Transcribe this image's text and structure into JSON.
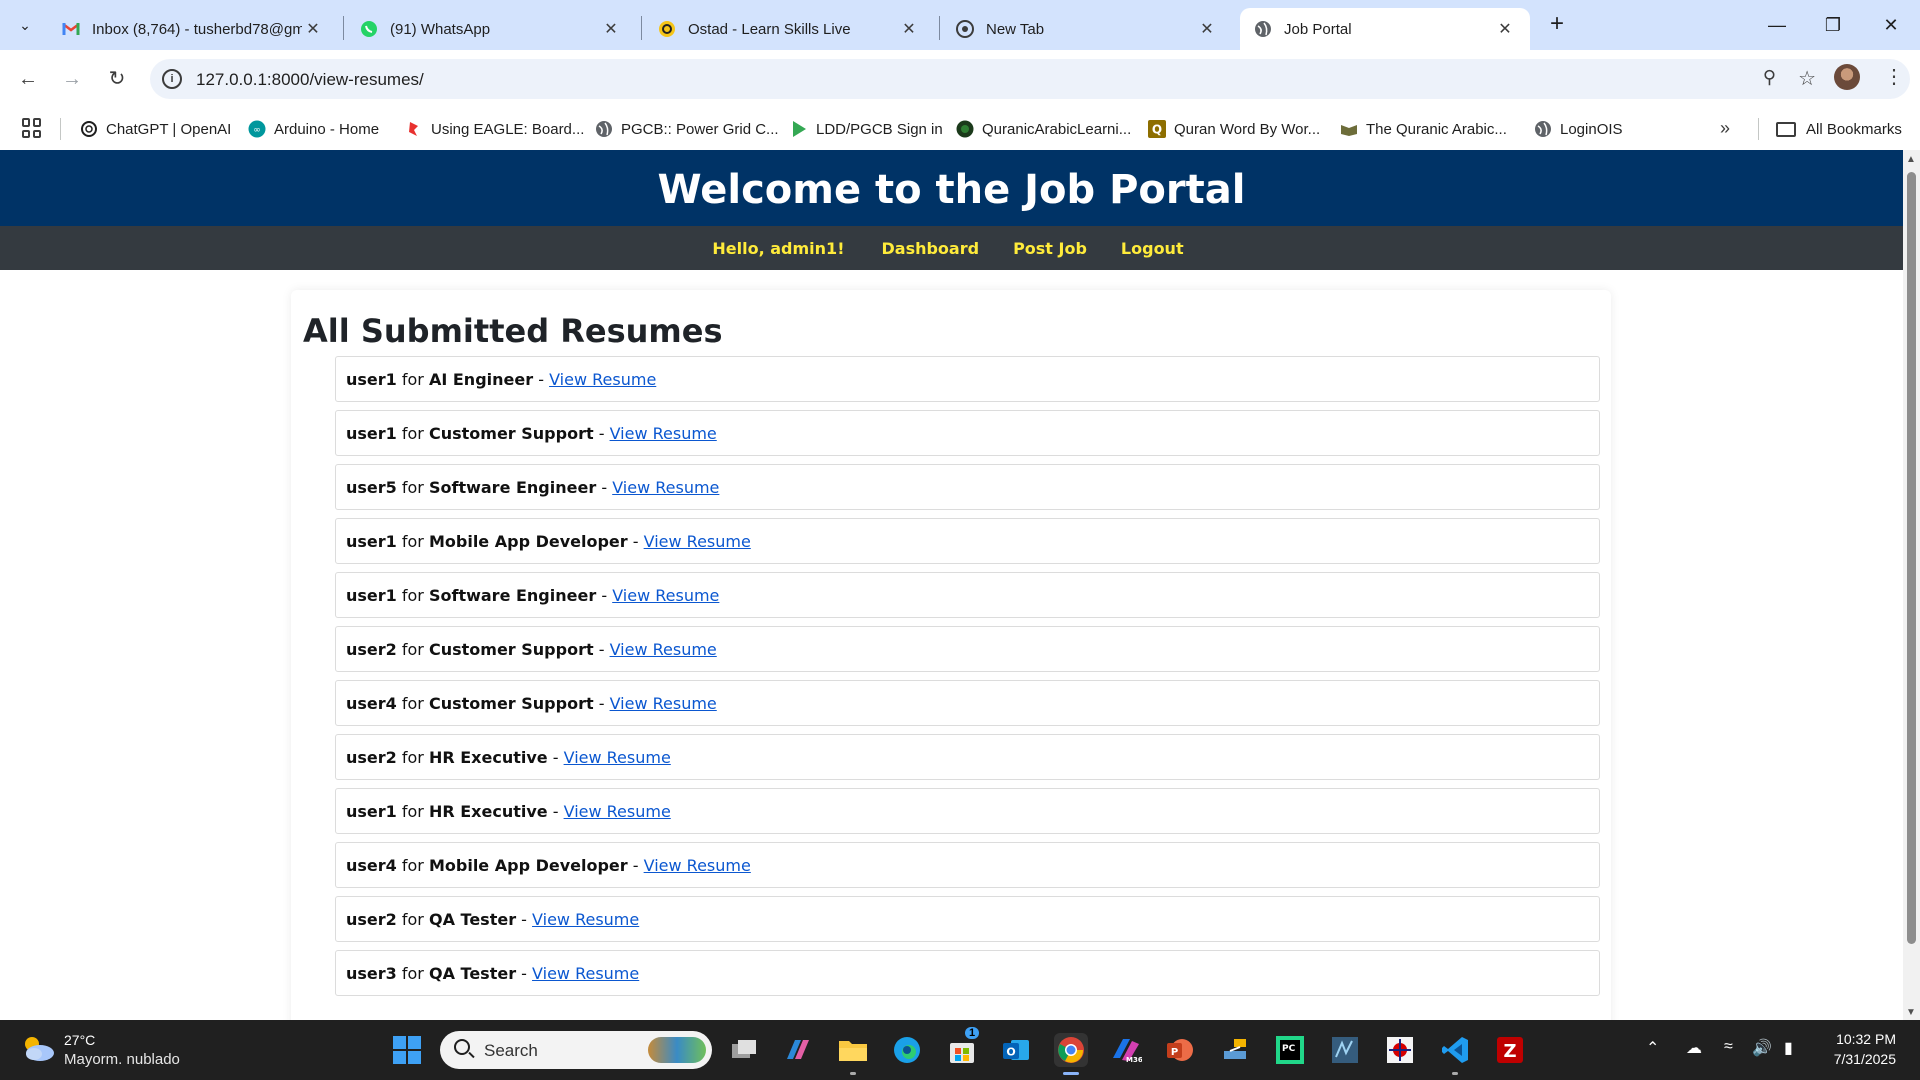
{
  "browser": {
    "tabs": [
      {
        "title": "Inbox (8,764) - tusherbd78@gm",
        "icon": "gmail-icon"
      },
      {
        "title": "(91) WhatsApp",
        "icon": "whatsapp-icon"
      },
      {
        "title": "Ostad - Learn Skills Live",
        "icon": "ostad-icon"
      },
      {
        "title": "New Tab",
        "icon": "chrome-icon"
      },
      {
        "title": "Job Portal",
        "icon": "globe-icon",
        "active": true
      }
    ],
    "url": "127.0.0.1:8000/view-resumes/",
    "bookmarks": [
      {
        "label": "ChatGPT | OpenAI"
      },
      {
        "label": "Arduino - Home"
      },
      {
        "label": "Using EAGLE: Board..."
      },
      {
        "label": "PGCB:: Power Grid C..."
      },
      {
        "label": "LDD/PGCB Sign in"
      },
      {
        "label": "QuranicArabicLearni..."
      },
      {
        "label": "Quran Word By Wor..."
      },
      {
        "label": "The Quranic Arabic..."
      },
      {
        "label": "LoginOIS"
      }
    ],
    "all_bookmarks_label": "All Bookmarks"
  },
  "site": {
    "title": "Welcome to the Job Portal",
    "nav": {
      "greeting": "Hello, admin1!",
      "dashboard": "Dashboard",
      "post_job": "Post Job",
      "logout": "Logout"
    }
  },
  "page": {
    "heading": "All Submitted Resumes",
    "link_label": "View Resume",
    "resumes": [
      {
        "user": "user1",
        "job": "AI Engineer"
      },
      {
        "user": "user1",
        "job": "Customer Support"
      },
      {
        "user": "user5",
        "job": "Software Engineer"
      },
      {
        "user": "user1",
        "job": "Mobile App Developer"
      },
      {
        "user": "user1",
        "job": "Software Engineer"
      },
      {
        "user": "user2",
        "job": "Customer Support"
      },
      {
        "user": "user4",
        "job": "Customer Support"
      },
      {
        "user": "user2",
        "job": "HR Executive"
      },
      {
        "user": "user1",
        "job": "HR Executive"
      },
      {
        "user": "user4",
        "job": "Mobile App Developer"
      },
      {
        "user": "user2",
        "job": "QA Tester"
      },
      {
        "user": "user3",
        "job": "QA Tester"
      }
    ]
  },
  "taskbar": {
    "weather_temp": "27°C",
    "weather_desc": "Mayorm. nublado",
    "search_placeholder": "Search",
    "time": "10:32 PM",
    "date": "7/31/2025",
    "store_badge": "1"
  },
  "colors": {
    "header_bg": "#003366",
    "nav_bg": "#343a40",
    "nav_text": "#ffeb3b",
    "link": "#0b57d0"
  }
}
